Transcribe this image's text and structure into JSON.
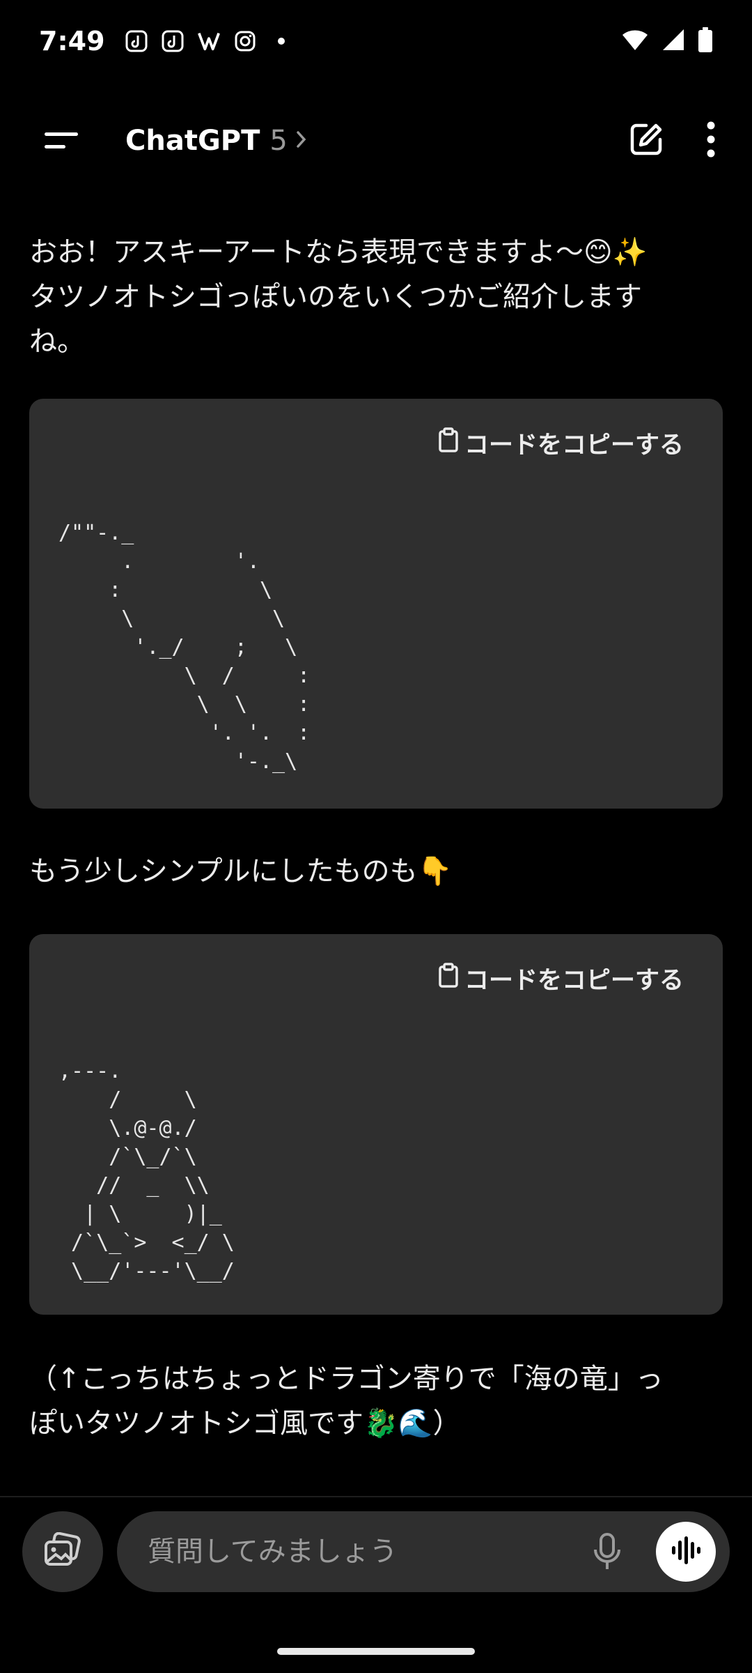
{
  "status": {
    "time": "7:49",
    "icons": [
      "tiktok-icon",
      "tiktok-icon",
      "vivid-icon",
      "instagram-icon",
      "dot-icon"
    ],
    "right_icons": [
      "wifi-icon",
      "signal-icon",
      "battery-icon"
    ]
  },
  "header": {
    "title": "ChatGPT",
    "model": "5",
    "menu_icon": "hamburger-icon",
    "new_chat_icon": "edit-icon",
    "more_icon": "kebab-icon"
  },
  "messages": {
    "intro_line1": "おお！アスキーアートなら表現できますよ〜😊✨",
    "intro_line2": "タツノオトシゴっぽいのをいくつかご紹介します",
    "intro_line3": "ね。",
    "code1": {
      "copy_label": "コードをコピーする",
      "ascii": "/\"\"-._\n     .        '.\n    :           \\\n     \\           \\\n      '._/    ;   \\\n          \\  /     :\n           \\  \\    :\n            '. '.  :\n              '-._\\"
    },
    "simple_line": "もう少しシンプルにしたものも👇",
    "code2": {
      "copy_label": "コードをコピーする",
      "ascii": ",---.\n    /     \\\n    \\.@-@./\n    /`\\_/`\\\n   //  _  \\\\\n  | \\     )|_\n /`\\_`>  <_/ \\\n \\__/'---'\\__/"
    },
    "outro_line1": "（↑こっちはちょっとドラゴン寄りで「海の竜」っ",
    "outro_line2": "ぽいタツノオトシゴ風です🐉🌊）"
  },
  "composer": {
    "placeholder": "質問してみましょう",
    "attach_icon": "image-attach-icon",
    "mic_icon": "microphone-icon",
    "voice_icon": "voice-mode-icon"
  },
  "colors": {
    "background": "#000000",
    "code_bg": "#2f2f2f",
    "text": "#ececec",
    "muted": "#9a9a9a"
  }
}
